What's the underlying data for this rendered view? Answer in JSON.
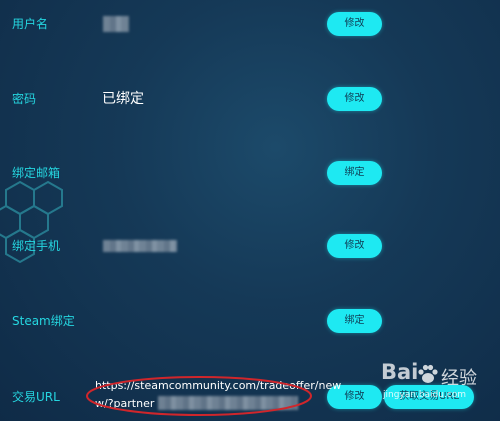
{
  "rows": [
    {
      "label": "用户名",
      "value": "",
      "button": "修改"
    },
    {
      "label": "密码",
      "value": "已绑定",
      "button": "修改"
    },
    {
      "label": "绑定邮箱",
      "value": "",
      "button": "绑定"
    },
    {
      "label": "绑定手机",
      "value": "",
      "button": "修改"
    },
    {
      "label": "Steam绑定",
      "value": "",
      "button": "绑定"
    }
  ],
  "trade": {
    "label": "交易URL",
    "url_line1": "https://steamcommunity.com/tradeoffer/new",
    "url_line2": "w/?partner",
    "edit_button": "修改",
    "get_button": "获取交易URL"
  },
  "watermark": {
    "brand_prefix": "Bai",
    "brand_suffix": "经验",
    "url": "jingyan.baidu.com"
  },
  "colors": {
    "background": "#153957",
    "accent": "#1ee9f2",
    "label": "#25d6e0",
    "annotation": "#d0262b"
  },
  "icons": {
    "watermark_logo": "paw-icon",
    "background_decoration": "hexagon-pattern"
  }
}
